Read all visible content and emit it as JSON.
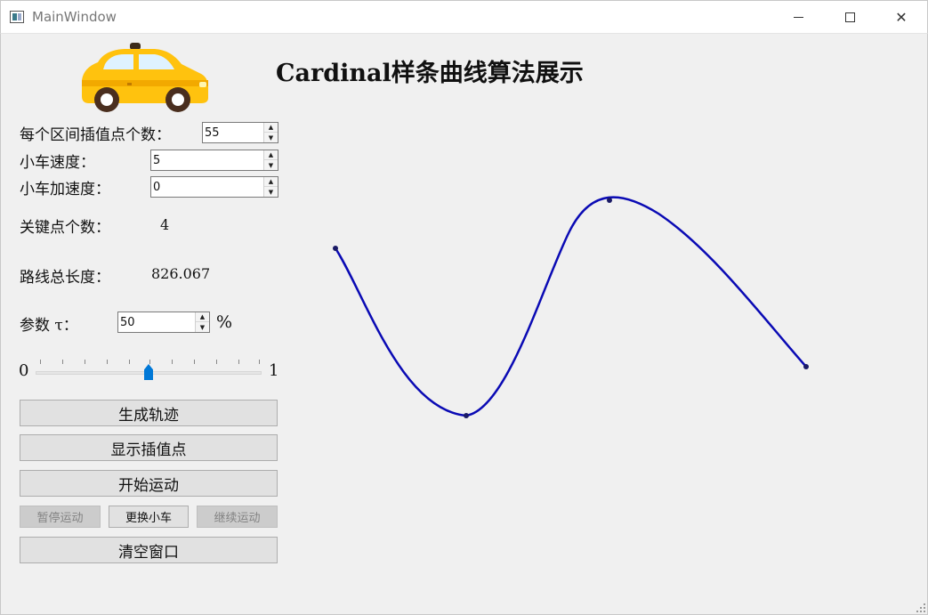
{
  "window": {
    "title": "MainWindow",
    "minimize_symbol": "—",
    "close_symbol": "✕"
  },
  "heading": "Cardinal样条曲线算法展示",
  "controls": {
    "interp_points_label": "每个区间插值点个数：",
    "interp_points_value": "55",
    "speed_label": "小车速度：",
    "speed_value": "5",
    "accel_label": "小车加速度：",
    "accel_value": "0",
    "keypoints_label": "关键点个数：",
    "keypoints_value": "4",
    "length_label": "路线总长度：",
    "length_value": "826.067",
    "tau_label": "参数 τ：",
    "tau_value": "50",
    "tau_unit": "%",
    "slider_min": "0",
    "slider_max": "1",
    "slider_level": 0.5
  },
  "buttons": {
    "generate": "生成轨迹",
    "show_points": "显示插值点",
    "start": "开始运动",
    "pause": "暂停运动",
    "change_car": "更换小车",
    "resume": "继续运动",
    "clear": "清空窗口"
  },
  "colors": {
    "curve": "#0a0ab4",
    "slider_accent": "#0078d7",
    "car_body": "#ffc20e"
  },
  "icons": {
    "app": "window-icon",
    "car": "taxi-car-icon"
  }
}
